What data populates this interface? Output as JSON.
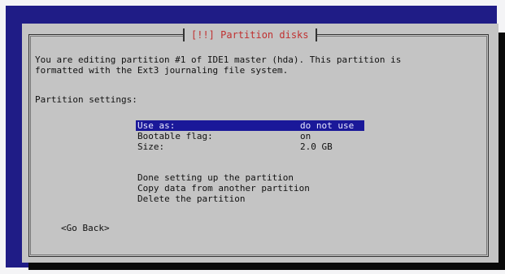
{
  "dialog": {
    "title": "[!!] Partition disks",
    "description_line1": "You are editing partition #1 of IDE1 master (hda). This partition is",
    "description_line2": "formatted with the Ext3 journaling file system.",
    "settings_heading": "Partition settings:"
  },
  "settings": [
    {
      "label": "Use as:",
      "value": "do not use",
      "selected": true
    },
    {
      "label": "Bootable flag:",
      "value": "on",
      "selected": false
    },
    {
      "label": "Size:",
      "value": "2.0 GB",
      "selected": false
    }
  ],
  "actions": [
    "Done setting up the partition",
    "Copy data from another partition",
    "Delete the partition"
  ],
  "buttons": {
    "go_back": "<Go Back>"
  },
  "colors": {
    "background": "#1f1c86",
    "dialog": "#c4c4c4",
    "title_text": "#c03030",
    "selection": "#1a1899"
  }
}
